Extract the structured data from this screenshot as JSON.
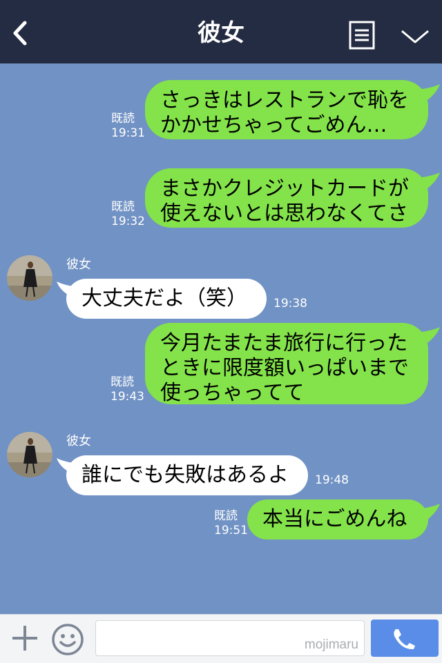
{
  "header": {
    "title": "彼女",
    "back_icon": "chevron-left-icon",
    "menu_icon": "list-icon",
    "collapse_icon": "chevron-down-icon"
  },
  "messages": [
    {
      "direction": "out",
      "lines": [
        "さっきはレストランで恥を",
        "かかせちゃってごめん…"
      ],
      "read": "既読",
      "time": "19:31"
    },
    {
      "direction": "out",
      "lines": [
        "まさかクレジットカードが",
        "使えないとは思わなくてさ"
      ],
      "read": "既読",
      "time": "19:32"
    },
    {
      "direction": "in",
      "sender": "彼女",
      "lines": [
        "大丈夫だよ（笑）"
      ],
      "time": "19:38"
    },
    {
      "direction": "out",
      "lines": [
        "今月たまたま旅行に行った",
        "ときに限度額いっぱいまで",
        "使っちゃってて"
      ],
      "read": "既読",
      "time": "19:43"
    },
    {
      "direction": "in",
      "sender": "彼女",
      "lines": [
        "誰にでも失敗はあるよ"
      ],
      "time": "19:48"
    },
    {
      "direction": "out",
      "lines": [
        "本当にごめんね"
      ],
      "read": "既読",
      "time": "19:51"
    }
  ],
  "input_bar": {
    "watermark": "mojimaru",
    "plus_icon": "plus-icon",
    "emoji_icon": "smile-icon",
    "call_icon": "phone-icon"
  },
  "colors": {
    "header_bg": "#242c43",
    "chat_bg": "#7192c4",
    "outgoing_bubble": "#84e34a",
    "incoming_bubble": "#ffffff",
    "call_button": "#5a8de8"
  }
}
